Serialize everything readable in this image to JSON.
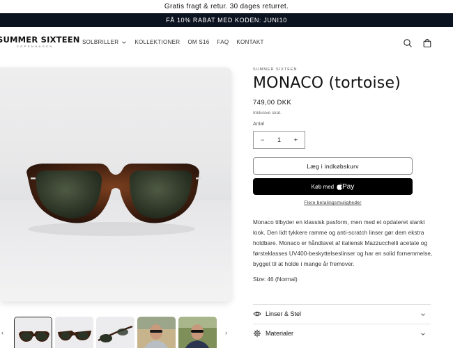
{
  "announcement": {
    "top": "Gratis fragt & retur. 30 dages returret.",
    "bar": "FÅ 10% RABAT MED KODEN: JUNI10"
  },
  "header": {
    "logo_main": "SUMMER SIXTEEN",
    "logo_sub": "COPENHAGEN",
    "nav": [
      {
        "label": "SOLBRILLER",
        "has_dropdown": true
      },
      {
        "label": "KOLLEKTIONER"
      },
      {
        "label": "OM S16"
      },
      {
        "label": "FAQ"
      },
      {
        "label": "KONTAKT"
      }
    ],
    "icons": [
      "search-icon",
      "bag-icon"
    ]
  },
  "product": {
    "vendor": "SUMMER SIXTEEN",
    "title": "MONACO (tortoise)",
    "price": "749,00 DKK",
    "tax_note": "Inklusive skat.",
    "quantity_label": "Antal",
    "quantity": "1",
    "minus": "−",
    "plus": "+",
    "add_to_cart": "Læg i indkøbskurv",
    "buy_with": "Køb med",
    "pay_brand": "Pay",
    "more_payment": "Flere betalingsmuligheder",
    "description": "Monaco tilbyder en klassisk pasform, men med et opdateret slankt look. Den lidt tykkere ramme og anti-scratch linser gør dem ekstra holdbare. Monaco er håndlavet af italiensk Mazzucchelli acetate og førsteklasses UV400-beskyttelseslinser og har en solid fornemmelse, bygget til at holde i mange år fremover.",
    "size": "Size: 46 (Normal)"
  },
  "accordions": [
    {
      "label": "Linser & Stel",
      "icon": "eye-icon"
    },
    {
      "label": "Materialer",
      "icon": "gear-icon"
    }
  ],
  "thumbnails": {
    "prev": "‹",
    "next": "›",
    "items": [
      "front",
      "angle",
      "side",
      "model-1",
      "model-2"
    ]
  },
  "colors": {
    "announcement_bg": "#0b1220",
    "primary_button": "#000000",
    "tortoise": "#5a2e1a"
  }
}
